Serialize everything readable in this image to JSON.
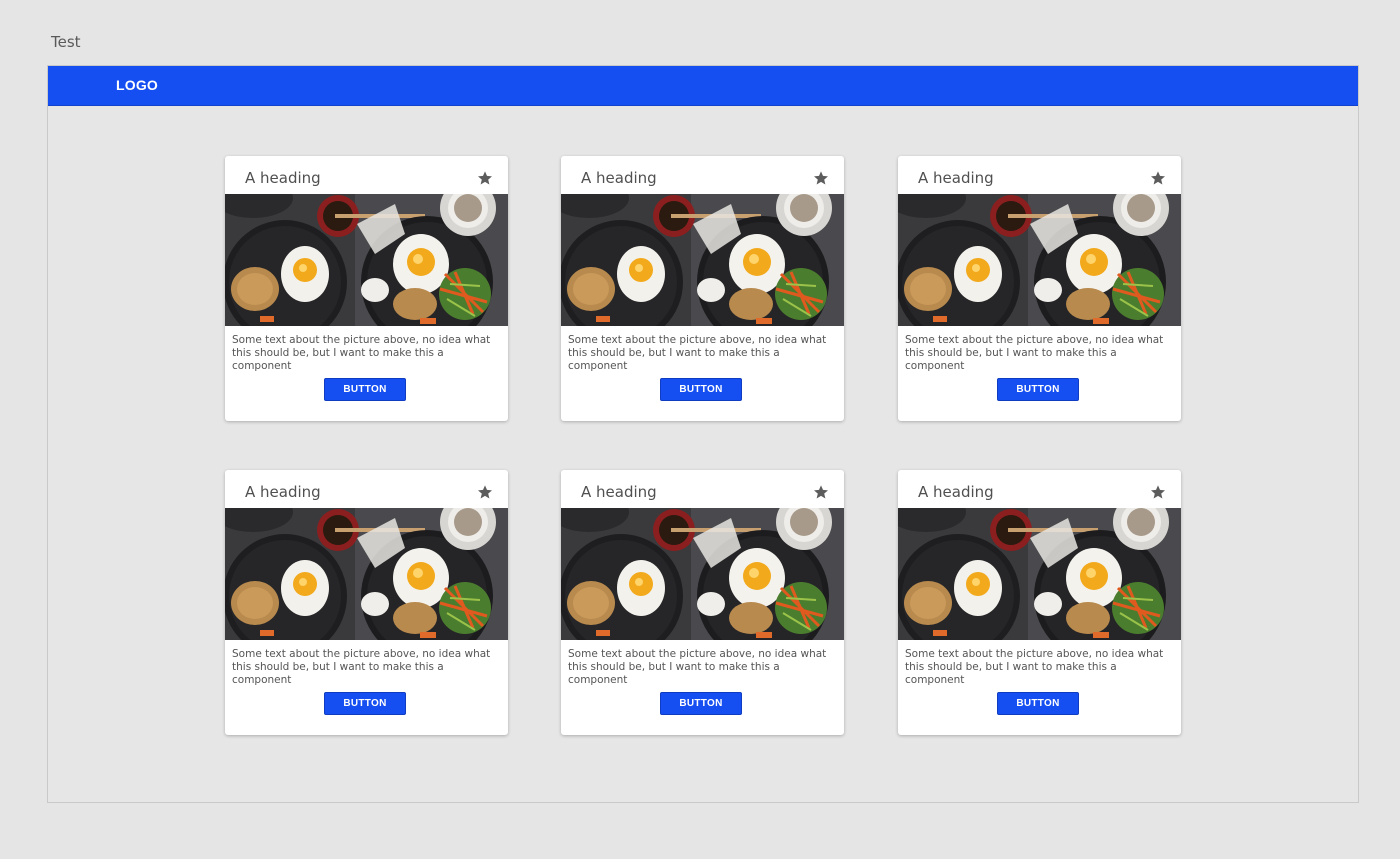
{
  "artboard": {
    "label": "Test"
  },
  "header": {
    "logo": "LOGO"
  },
  "cards": [
    {
      "heading": "A heading",
      "text": "Some text about the picture above, no idea what this should be, but I want to make this a component",
      "button_label": "BUTTON",
      "icon": "star-icon"
    },
    {
      "heading": "A heading",
      "text": "Some text about the picture above, no idea what this should be, but I want to make this a component",
      "button_label": "BUTTON",
      "icon": "star-icon"
    },
    {
      "heading": "A heading",
      "text": "Some text about the picture above, no idea what this should be, but I want to make this a component",
      "button_label": "BUTTON",
      "icon": "star-icon"
    },
    {
      "heading": "A heading",
      "text": "Some text about the picture above, no idea what this should be, but I want to make this a component",
      "button_label": "BUTTON",
      "icon": "star-icon"
    },
    {
      "heading": "A heading",
      "text": "Some text about the picture above, no idea what this should be, but I want to make this a component",
      "button_label": "BUTTON",
      "icon": "star-icon"
    },
    {
      "heading": "A heading",
      "text": "Some text about the picture above, no idea what this should be, but I want to make this a component",
      "button_label": "BUTTON",
      "icon": "star-icon"
    }
  ],
  "colors": {
    "brand": "#154ff2",
    "background": "#e6e6e6",
    "card": "#ffffff"
  }
}
